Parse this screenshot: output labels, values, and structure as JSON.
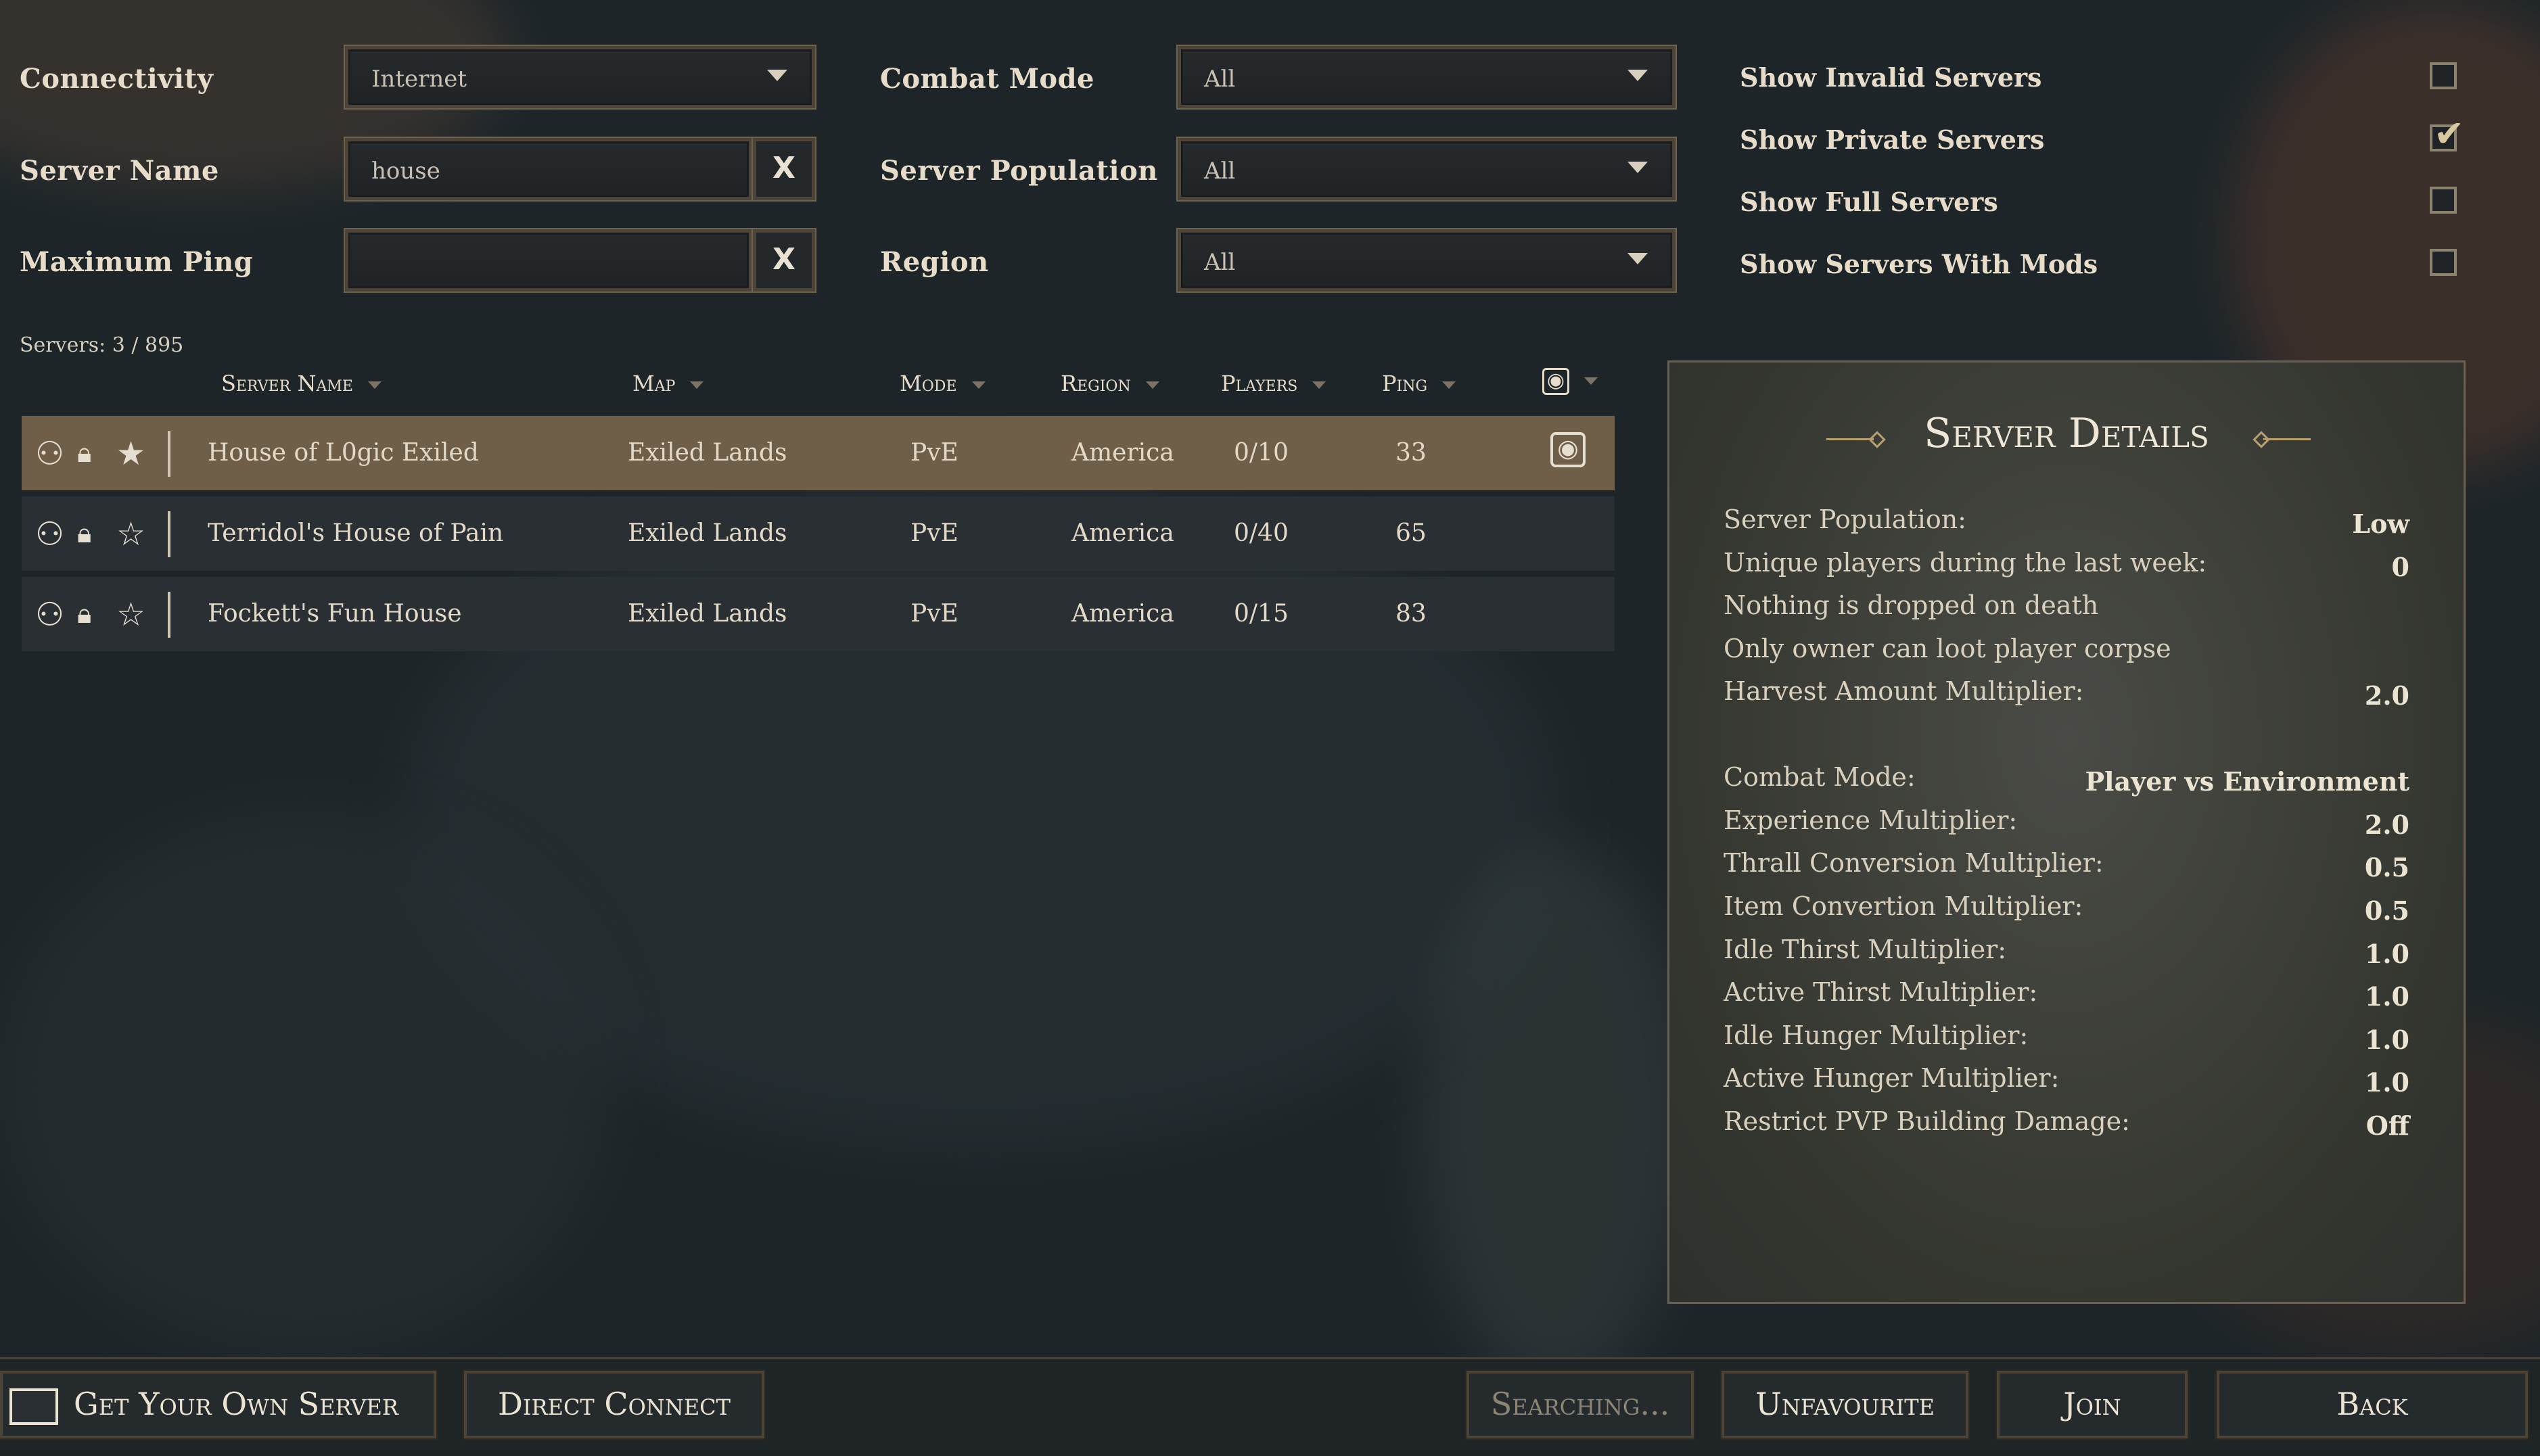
{
  "filters": {
    "connectivity": {
      "label": "Connectivity",
      "value": "Internet"
    },
    "server_name": {
      "label": "Server Name",
      "value": "house",
      "clear": "X"
    },
    "max_ping": {
      "label": "Maximum Ping",
      "value": "",
      "clear": "X"
    },
    "combat_mode": {
      "label": "Combat Mode",
      "value": "All"
    },
    "server_population": {
      "label": "Server Population",
      "value": "All"
    },
    "region": {
      "label": "Region",
      "value": "All"
    }
  },
  "toggles": [
    {
      "label": "Show Invalid Servers",
      "checked": false
    },
    {
      "label": "Show Private Servers",
      "checked": true
    },
    {
      "label": "Show Full Servers",
      "checked": false
    },
    {
      "label": "Show Servers With Mods",
      "checked": false
    }
  ],
  "servers_count": "Servers: 3 / 895",
  "table": {
    "headers": [
      "Server Name",
      "Map",
      "Mode",
      "Region",
      "Players",
      "Ping"
    ],
    "rows": [
      {
        "name": "House of L0gic Exiled",
        "map": "Exiled Lands",
        "mode": "PvE",
        "region": "America",
        "players": "0/10",
        "ping": "33",
        "favourite": true,
        "battleye": true,
        "selected": true
      },
      {
        "name": "Terridol's House of Pain",
        "map": "Exiled Lands",
        "mode": "PvE",
        "region": "America",
        "players": "0/40",
        "ping": "65",
        "favourite": false,
        "battleye": false,
        "selected": false
      },
      {
        "name": "Fockett's Fun House",
        "map": "Exiled Lands",
        "mode": "PvE",
        "region": "America",
        "players": "0/15",
        "ping": "83",
        "favourite": false,
        "battleye": false,
        "selected": false
      }
    ]
  },
  "details": {
    "title": "Server Details",
    "items1": [
      {
        "k": "Server Population:",
        "v": "Low"
      },
      {
        "k": "Unique players during the last week:",
        "v": "0"
      },
      {
        "k": "Nothing is dropped on death",
        "v": ""
      },
      {
        "k": "Only owner can loot player corpse",
        "v": ""
      },
      {
        "k": "Harvest Amount Multiplier:",
        "v": "2.0"
      }
    ],
    "items2": [
      {
        "k": "Combat Mode:",
        "v": "Player vs Environment"
      },
      {
        "k": "Experience Multiplier:",
        "v": "2.0"
      },
      {
        "k": "Thrall Conversion Multiplier:",
        "v": "0.5"
      },
      {
        "k": "Item Convertion Multiplier:",
        "v": "0.5"
      },
      {
        "k": "Idle Thirst Multiplier:",
        "v": "1.0"
      },
      {
        "k": "Active Thirst Multiplier:",
        "v": "1.0"
      },
      {
        "k": "Idle Hunger Multiplier:",
        "v": "1.0"
      },
      {
        "k": "Active Hunger Multiplier:",
        "v": "1.0"
      },
      {
        "k": "Restrict PVP Building Damage:",
        "v": "Off"
      }
    ]
  },
  "bottom": {
    "get_server": "Get Your Own Server",
    "direct_connect": "Direct Connect",
    "searching": "Searching...",
    "unfavourite": "Unfavourite",
    "join": "Join",
    "back": "Back"
  },
  "colors": {
    "selected_row": "#6f5f48",
    "row": "#2a2f33",
    "panel_border": "#6a6152"
  }
}
